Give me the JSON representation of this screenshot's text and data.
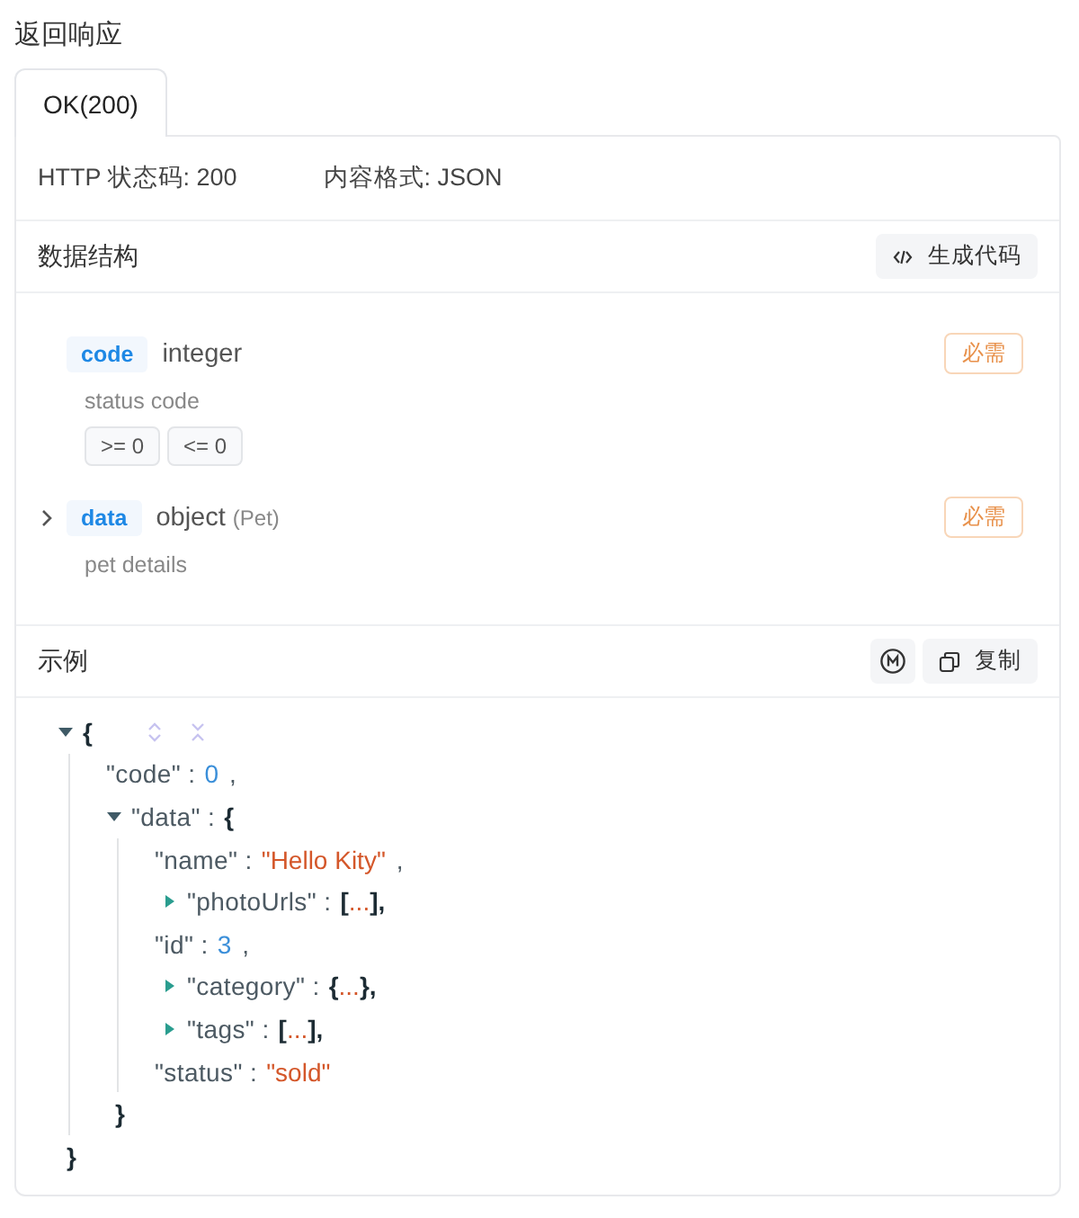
{
  "section_title": "返回响应",
  "tabs": [
    {
      "label": "OK(200)",
      "selected": true
    }
  ],
  "meta": [
    {
      "label": "HTTP 状态码: 200"
    },
    {
      "label": "内容格式: JSON"
    }
  ],
  "schema": {
    "title": "数据结构",
    "generate_button": "生成代码",
    "fields": [
      {
        "name": "code",
        "type": "integer",
        "required": "必需",
        "description": "status code",
        "constraints": [
          ">= 0",
          "<= 0"
        ]
      },
      {
        "name": "data",
        "type": "object",
        "ref": "(Pet)",
        "required": "必需",
        "description": "pet details",
        "expanded": false
      }
    ]
  },
  "example": {
    "title": "示例",
    "copy_button": "复制",
    "tree": {
      "kind": "object",
      "expanded": true,
      "open": "{",
      "close": "}",
      "children": [
        {
          "key": "\"code\" :",
          "kind": "number",
          "value": "0",
          "comma": ","
        },
        {
          "key": "\"data\" :",
          "kind": "object",
          "expanded": true,
          "open": "{",
          "close": "}",
          "children": [
            {
              "key": "\"name\" :",
              "kind": "string",
              "value": "\"Hello Kity\"",
              "comma": ","
            },
            {
              "key": "\"photoUrls\" :",
              "kind": "array",
              "expanded": false,
              "open": "[",
              "ellipsis": "...",
              "close": "],"
            },
            {
              "key": "\"id\" :",
              "kind": "number",
              "value": "3",
              "comma": ","
            },
            {
              "key": "\"category\" :",
              "kind": "object",
              "expanded": false,
              "open": "{",
              "ellipsis": "...",
              "close": "},"
            },
            {
              "key": "\"tags\" :",
              "kind": "array",
              "expanded": false,
              "open": "[",
              "ellipsis": "...",
              "close": "],"
            },
            {
              "key": "\"status\" :",
              "kind": "string",
              "value": "\"sold\""
            }
          ]
        }
      ]
    }
  }
}
